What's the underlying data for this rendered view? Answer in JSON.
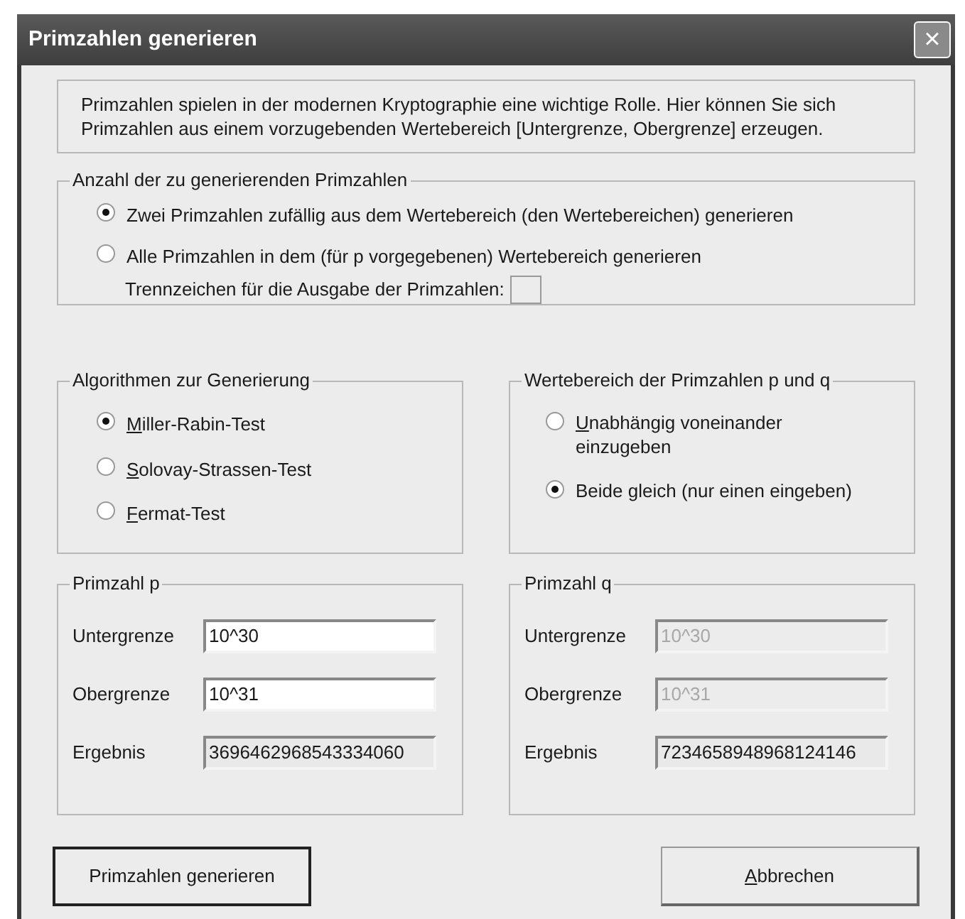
{
  "window": {
    "title": "Primzahlen generieren",
    "close": "×"
  },
  "info": "Primzahlen spielen in der modernen Kryptographie eine wichtige Rolle. Hier können Sie sich Primzahlen aus einem vorzugebenden Wertebereich [Untergrenze, Obergrenze] erzeugen.",
  "count_group": {
    "title": "Anzahl der zu generierenden Primzahlen",
    "options": [
      {
        "label": "Zwei Primzahlen zufällig aus dem Wertebereich (den Wertebereichen) generieren",
        "selected": true,
        "underline_first": false
      },
      {
        "label": "Alle Primzahlen in dem (für p vorgegebenen) Wertebereich generieren",
        "selected": false,
        "underline_first": false
      }
    ],
    "separator": {
      "label": "Trennzeichen für die Ausgabe der Primzahlen:",
      "disabled": true
    }
  },
  "algorithm_group": {
    "title": "Algorithmen zur Generierung",
    "options": [
      {
        "label": "Miller-Rabin-Test",
        "selected": true,
        "underline_first": true
      },
      {
        "label": "Solovay-Strassen-Test",
        "selected": false,
        "underline_first": true
      },
      {
        "label": "Fermat-Test",
        "selected": false,
        "underline_first": true
      }
    ]
  },
  "range_group": {
    "title": "Wertebereich der Primzahlen p und q",
    "options": [
      {
        "label": "Unabhängig voneinander einzugeben",
        "selected": false,
        "underline_first": true
      },
      {
        "label": "Beide gleich (nur einen eingeben)",
        "selected": true,
        "underline_first": false
      }
    ]
  },
  "prime_groups": [
    {
      "title": "Primzahl p",
      "fields": [
        {
          "label": "Untergrenze",
          "value": "10^30",
          "disabled": false,
          "readonly": false
        },
        {
          "label": "Obergrenze",
          "value": "10^31",
          "disabled": false,
          "readonly": false
        },
        {
          "label": "Ergebnis",
          "value": "3696462968543334060",
          "disabled": false,
          "readonly": true
        }
      ]
    },
    {
      "title": "Primzahl q",
      "fields": [
        {
          "label": "Untergrenze",
          "value": "10^30",
          "disabled": true,
          "readonly": false
        },
        {
          "label": "Obergrenze",
          "value": "10^31",
          "disabled": true,
          "readonly": false
        },
        {
          "label": "Ergebnis",
          "value": "7234658948968124146",
          "disabled": false,
          "readonly": true
        }
      ]
    }
  ],
  "buttons": [
    {
      "label": "Primzahlen generieren",
      "default": true,
      "underline_first": false
    },
    {
      "label": "Abbrechen",
      "default": false,
      "underline_first": true
    }
  ]
}
